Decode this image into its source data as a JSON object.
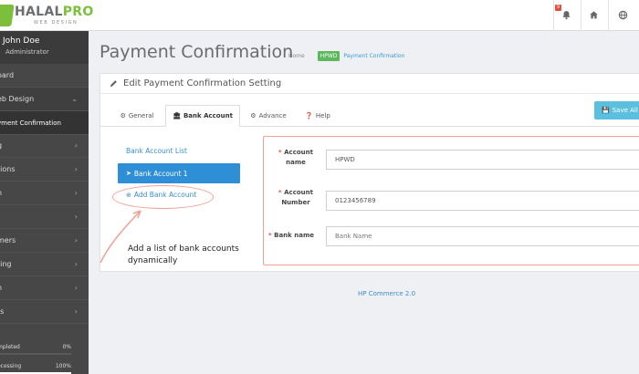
{
  "brand": {
    "name_a": "HALAL",
    "name_b": "PRO",
    "subtitle": "WEB DESIGN"
  },
  "header": {
    "notification_count": "9"
  },
  "sidebar": {
    "user_name": "John Doe",
    "user_role": "Administrator",
    "items": [
      {
        "label": "oard"
      },
      {
        "label": "eb Design"
      },
      {
        "label": "yment Confirmation"
      },
      {
        "label": "g"
      },
      {
        "label": "tions"
      },
      {
        "label": "n"
      },
      {
        "label": ""
      },
      {
        "label": "mers"
      },
      {
        "label": "ting"
      },
      {
        "label": "n"
      },
      {
        "label": "ts"
      }
    ],
    "progress": [
      {
        "label": "mpleted",
        "percent": "0%",
        "value": 0
      },
      {
        "label": "ocessing",
        "percent": "100%",
        "value": 100
      }
    ]
  },
  "page": {
    "title": "Payment Confirmation",
    "breadcrumb": {
      "home": "Home",
      "tag": "HPWD",
      "current": "Payment Confirmation"
    }
  },
  "panel": {
    "title": "Edit Payment Confirmation Setting",
    "tabs": [
      {
        "label": "General"
      },
      {
        "label": "Bank Account"
      },
      {
        "label": "Advance"
      },
      {
        "label": "Help"
      }
    ],
    "save_label": "Save All S"
  },
  "bank_list": {
    "title": "Bank Account List",
    "active_item": "Bank Account 1",
    "add_label": "Add Bank Account"
  },
  "form": {
    "account_name_label_1": "Account",
    "account_name_label_2": "name",
    "account_name_value": "HPWD",
    "account_number_label_1": "Account",
    "account_number_label_2": "Number",
    "account_number_value": "0123456789",
    "bank_name_label": "Bank name",
    "bank_name_placeholder": "Bank Name"
  },
  "annotation": {
    "line1": "Add a list of bank accounts",
    "line2": "dynamically"
  },
  "footer": {
    "text": "HP Commerce 2.0"
  },
  "colors": {
    "accent": "#2f8fd6",
    "brand_green": "#7cbf3a",
    "annotation": "#f2a097",
    "sidebar": "#474747"
  }
}
